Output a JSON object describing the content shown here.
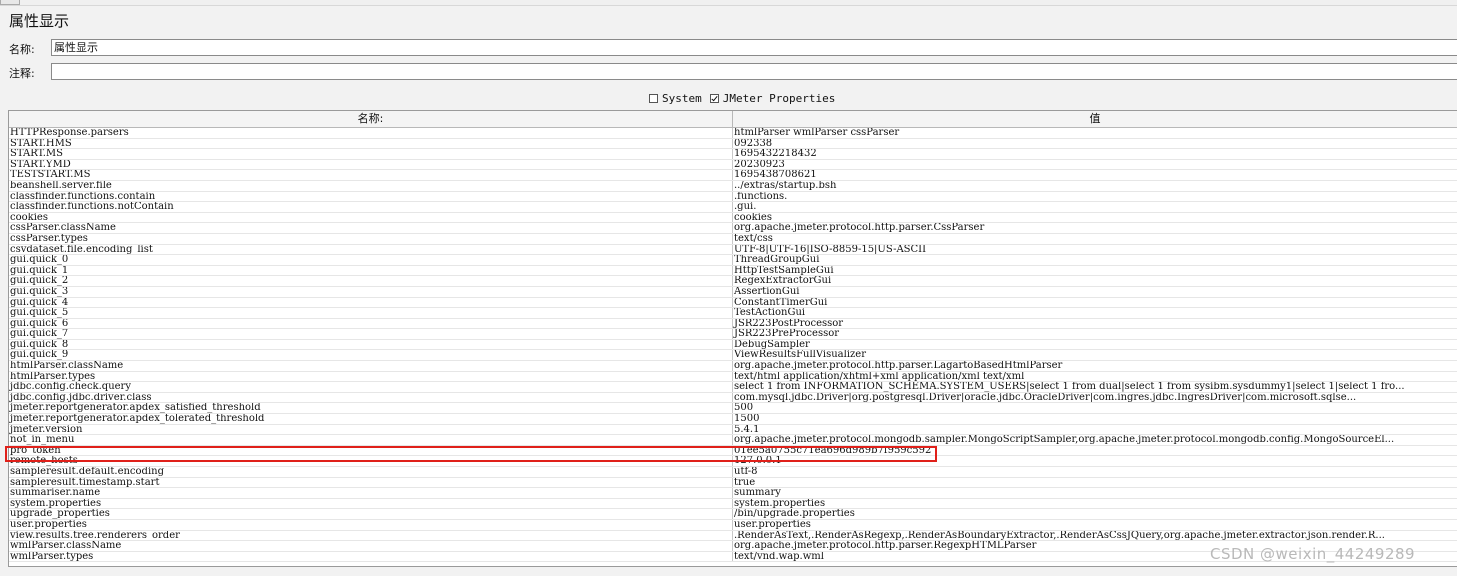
{
  "page_title": "属性显示",
  "form": {
    "name_label": "名称:",
    "name_value": "属性显示",
    "comment_label": "注释:",
    "comment_value": ""
  },
  "checkboxes": [
    {
      "label": "System",
      "checked": false
    },
    {
      "label": "JMeter Properties",
      "checked": true
    }
  ],
  "table": {
    "headers": [
      "名称:",
      "值"
    ],
    "rows": [
      [
        "HTTPResponse.parsers",
        "htmlParser wmlParser cssParser"
      ],
      [
        "START.HMS",
        "092338"
      ],
      [
        "START.MS",
        "1695432218432"
      ],
      [
        "START.YMD",
        "20230923"
      ],
      [
        "TESTSTART.MS",
        "1695438708621"
      ],
      [
        "beanshell.server.file",
        "../extras/startup.bsh"
      ],
      [
        "classfinder.functions.contain",
        ".functions."
      ],
      [
        "classfinder.functions.notContain",
        ".gui."
      ],
      [
        "cookies",
        "cookies"
      ],
      [
        "cssParser.className",
        "org.apache.jmeter.protocol.http.parser.CssParser"
      ],
      [
        "cssParser.types",
        "text/css"
      ],
      [
        "csvdataset.file.encoding_list",
        "UTF-8|UTF-16|ISO-8859-15|US-ASCII"
      ],
      [
        "gui.quick_0",
        "ThreadGroupGui"
      ],
      [
        "gui.quick_1",
        "HttpTestSampleGui"
      ],
      [
        "gui.quick_2",
        "RegexExtractorGui"
      ],
      [
        "gui.quick_3",
        "AssertionGui"
      ],
      [
        "gui.quick_4",
        "ConstantTimerGui"
      ],
      [
        "gui.quick_5",
        "TestActionGui"
      ],
      [
        "gui.quick_6",
        "JSR223PostProcessor"
      ],
      [
        "gui.quick_7",
        "JSR223PreProcessor"
      ],
      [
        "gui.quick_8",
        "DebugSampler"
      ],
      [
        "gui.quick_9",
        "ViewResultsFullVisualizer"
      ],
      [
        "htmlParser.className",
        "org.apache.jmeter.protocol.http.parser.LagartoBasedHtmlParser"
      ],
      [
        "htmlParser.types",
        "text/html application/xhtml+xml application/xml text/xml"
      ],
      [
        "jdbc.config.check.query",
        "select 1 from INFORMATION_SCHEMA.SYSTEM_USERS|select 1 from dual|select 1 from sysibm.sysdummy1|select 1|select 1 fro..."
      ],
      [
        "jdbc.config.jdbc.driver.class",
        "com.mysql.jdbc.Driver|org.postgresql.Driver|oracle.jdbc.OracleDriver|com.ingres.jdbc.IngresDriver|com.microsoft.sqlse..."
      ],
      [
        "jmeter.reportgenerator.apdex_satisfied_threshold",
        "500"
      ],
      [
        "jmeter.reportgenerator.apdex_tolerated_threshold",
        "1500"
      ],
      [
        "jmeter.version",
        "5.4.1"
      ],
      [
        "not_in_menu",
        "org.apache.jmeter.protocol.mongodb.sampler.MongoScriptSampler,org.apache.jmeter.protocol.mongodb.config.MongoSourceEl..."
      ],
      [
        "pro_token",
        "01ee5a0755c71ea696d989b7f959c592"
      ],
      [
        "remote_hosts",
        "127.0.0.1"
      ],
      [
        "sampleresult.default.encoding",
        "utf-8"
      ],
      [
        "sampleresult.timestamp.start",
        "true"
      ],
      [
        "summariser.name",
        "summary"
      ],
      [
        "system.properties",
        "system.properties"
      ],
      [
        "upgrade_properties",
        "/bin/upgrade.properties"
      ],
      [
        "user.properties",
        "user.properties"
      ],
      [
        "view.results.tree.renderers_order",
        ".RenderAsText,.RenderAsRegexp,.RenderAsBoundaryExtractor,.RenderAsCssJQuery,org.apache.jmeter.extractor.json.render.R..."
      ],
      [
        "wmlParser.className",
        "org.apache.jmeter.protocol.http.parser.RegexpHTMLParser"
      ],
      [
        "wmlParser.types",
        "text/vnd.wap.wml"
      ]
    ]
  },
  "highlight_row": "pro_token",
  "highlight_color": "#e0201a",
  "watermark": "CSDN @weixin_44249289"
}
